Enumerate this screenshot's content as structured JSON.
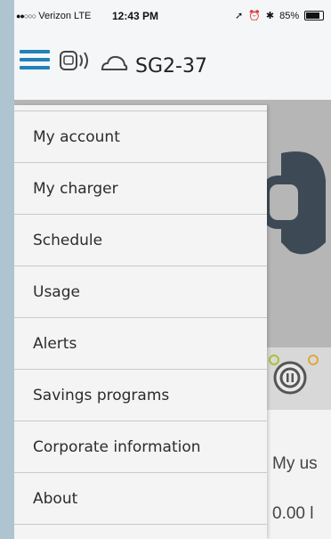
{
  "status_bar": {
    "carrier": "Verizon",
    "network": "LTE",
    "time": "12:43 PM",
    "battery": "85%"
  },
  "header": {
    "device_name": "SG2-37"
  },
  "menu": {
    "items": [
      {
        "label": "My account"
      },
      {
        "label": "My charger"
      },
      {
        "label": "Schedule"
      },
      {
        "label": "Usage"
      },
      {
        "label": "Alerts"
      },
      {
        "label": "Savings programs"
      },
      {
        "label": "Corporate information"
      },
      {
        "label": "About"
      }
    ]
  },
  "background_content": {
    "usage_label": "My us",
    "usage_value": "0.00 l"
  },
  "colors": {
    "accent": "#1f82b9",
    "page_background": "#aec4d1",
    "drawer_background": "#f4f4f4"
  }
}
